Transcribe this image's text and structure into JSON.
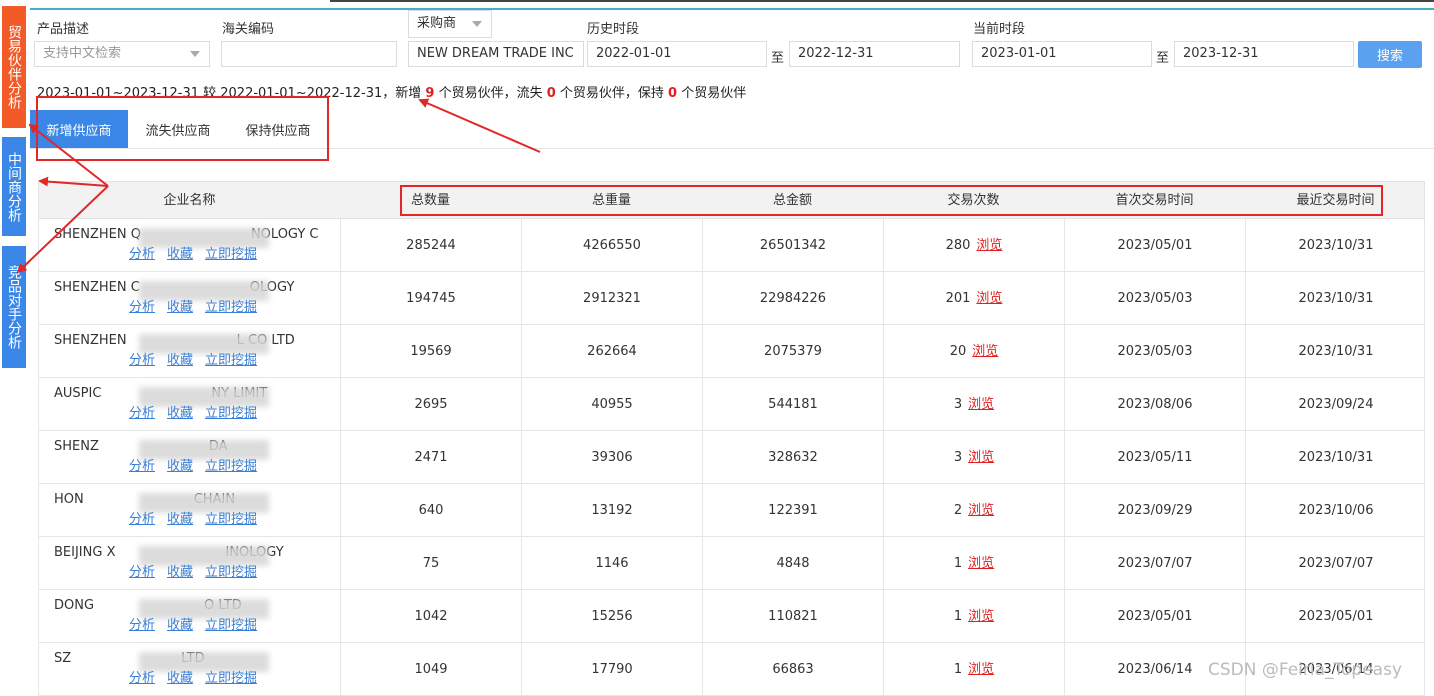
{
  "sidebar": {
    "tabs": [
      {
        "label": "贸易伙伴分析",
        "active": true
      },
      {
        "label": "中间商分析",
        "active": false
      },
      {
        "label": "竞品对手分析",
        "active": false
      }
    ]
  },
  "filters": {
    "product_label": "产品描述",
    "product_placeholder": "支持中文检索",
    "hs_label": "海关编码",
    "hs_value": "",
    "role_select": "采购商",
    "company_value": "NEW DREAM TRADE INC",
    "history_label": "历史时段",
    "history_start": "2022-01-01",
    "history_end": "2022-12-31",
    "current_label": "当前时段",
    "current_start": "2023-01-01",
    "current_end": "2023-12-31",
    "to_label": "至",
    "search_button": "搜索"
  },
  "summary": {
    "part1": "2023-01-01~2023-12-31 较 2022-01-01~2022-12-31，新增 ",
    "new_count": "9",
    "part2": " 个贸易伙伴，流失 ",
    "lost_count": "0",
    "part3": " 个贸易伙伴，保持 ",
    "kept_count": "0",
    "part4": " 个贸易伙伴"
  },
  "tabs": [
    {
      "label": "新增供应商",
      "active": true
    },
    {
      "label": "流失供应商",
      "active": false
    },
    {
      "label": "保持供应商",
      "active": false
    }
  ],
  "table": {
    "headers": [
      "企业名称",
      "总数量",
      "总重量",
      "总金额",
      "交易次数",
      "首次交易时间",
      "最近交易时间"
    ],
    "action_labels": {
      "analyze": "分析",
      "favorite": "收藏",
      "mine": "立即挖掘",
      "browse": "浏览"
    },
    "rows": [
      {
        "name_start": "SHENZHEN Q",
        "name_end": "NOLOGY C",
        "qty": "285244",
        "weight": "4266550",
        "amount": "26501342",
        "count": "280",
        "first": "2023/05/01",
        "last": "2023/10/31"
      },
      {
        "name_start": "SHENZHEN C",
        "name_end": "OLOGY",
        "qty": "194745",
        "weight": "2912321",
        "amount": "22984226",
        "count": "201",
        "first": "2023/05/03",
        "last": "2023/10/31"
      },
      {
        "name_start": "SHENZHEN",
        "name_end": "L CO LTD",
        "qty": "19569",
        "weight": "262664",
        "amount": "2075379",
        "count": "20",
        "first": "2023/05/03",
        "last": "2023/10/31"
      },
      {
        "name_start": "AUSPIC",
        "name_end": "NY LIMIT",
        "qty": "2695",
        "weight": "40955",
        "amount": "544181",
        "count": "3",
        "first": "2023/08/06",
        "last": "2023/09/24"
      },
      {
        "name_start": "SHENZ",
        "name_end": "DA",
        "qty": "2471",
        "weight": "39306",
        "amount": "328632",
        "count": "3",
        "first": "2023/05/11",
        "last": "2023/10/31"
      },
      {
        "name_start": "HON",
        "name_end": "CHAIN",
        "qty": "640",
        "weight": "13192",
        "amount": "122391",
        "count": "2",
        "first": "2023/09/29",
        "last": "2023/10/06"
      },
      {
        "name_start": "BEIJING X",
        "name_end": "INOLOGY",
        "qty": "75",
        "weight": "1146",
        "amount": "4848",
        "count": "1",
        "first": "2023/07/07",
        "last": "2023/07/07"
      },
      {
        "name_start": "DONG",
        "name_end": "O LTD",
        "qty": "1042",
        "weight": "15256",
        "amount": "110821",
        "count": "1",
        "first": "2023/05/01",
        "last": "2023/05/01"
      },
      {
        "name_start": "SZ",
        "name_end": "LTD",
        "qty": "1049",
        "weight": "17790",
        "amount": "66863",
        "count": "1",
        "first": "2023/06/14",
        "last": "2023/06/14"
      }
    ]
  },
  "watermark": "CSDN @Feiria_Topeasy"
}
